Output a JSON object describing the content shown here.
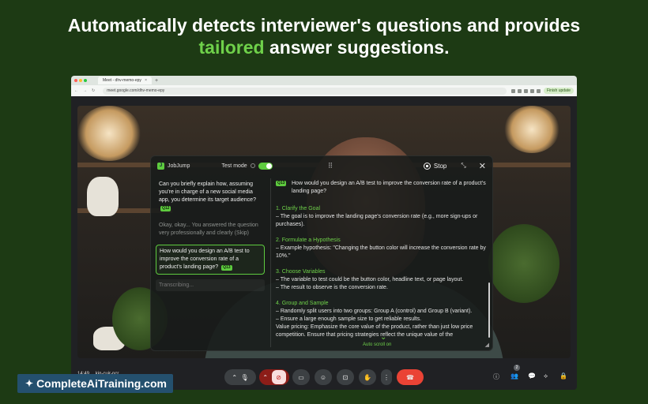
{
  "headline": {
    "line1": "Automatically detects interviewer's questions and provides",
    "accent": "tailored",
    "line2_rest": " answer suggestions."
  },
  "browser": {
    "tab_title": "Meet - dhv-memo-epy",
    "tab_close": "×",
    "new_tab": "+",
    "url": "meet.google.com/dhv-memo-epy",
    "finish_update": "Finish update"
  },
  "panel": {
    "logo": "JobJump",
    "test_mode": "Test mode",
    "stop_label": "Stop",
    "questions": [
      {
        "text": "Can you briefly explain how, assuming you're in charge of a new social media app, you determine its target audience?",
        "badge": "Q12"
      },
      {
        "text": "Okay, okay... You answered the question very professionally and clearly (Skip)",
        "badge": ""
      },
      {
        "text": "How would you design an A/B test to improve the conversion rate of a product's landing page?",
        "badge": "Q13"
      }
    ],
    "transcribing": "Transcribing...",
    "answer": {
      "badge": "Q13",
      "question": "How would you design an A/B test to improve the conversion rate of a product's landing page?",
      "sections": [
        {
          "head": "1. Clarify the Goal",
          "lines": [
            "– The goal is to improve the landing page's conversion rate (e.g., more sign-ups or purchases)."
          ]
        },
        {
          "head": "2. Formulate a Hypothesis",
          "lines": [
            "– Example hypothesis: \"Changing the button color will increase the conversion rate by 10%.\""
          ]
        },
        {
          "head": "3. Choose Variables",
          "lines": [
            "– The variable to test could be the button color, headline text, or page layout.",
            "– The result to observe is the conversion rate."
          ]
        },
        {
          "head": "4. Group and Sample",
          "lines": [
            "– Randomly split users into two groups: Group A (control) and Group B (variant).",
            "– Ensure a large enough sample size to get reliable results.",
            "Value pricing: Emphasize the core value of the product, rather than just low price competition. Ensure that pricing strategies reflect the unique value of the"
          ]
        }
      ],
      "auto_scroll": "Auto scroll on"
    }
  },
  "meet": {
    "time": "14:49",
    "meeting_code": "kig-cujr-ncr",
    "participants_count": "2"
  },
  "brand": {
    "name": "CompleteAiTraining.com"
  }
}
